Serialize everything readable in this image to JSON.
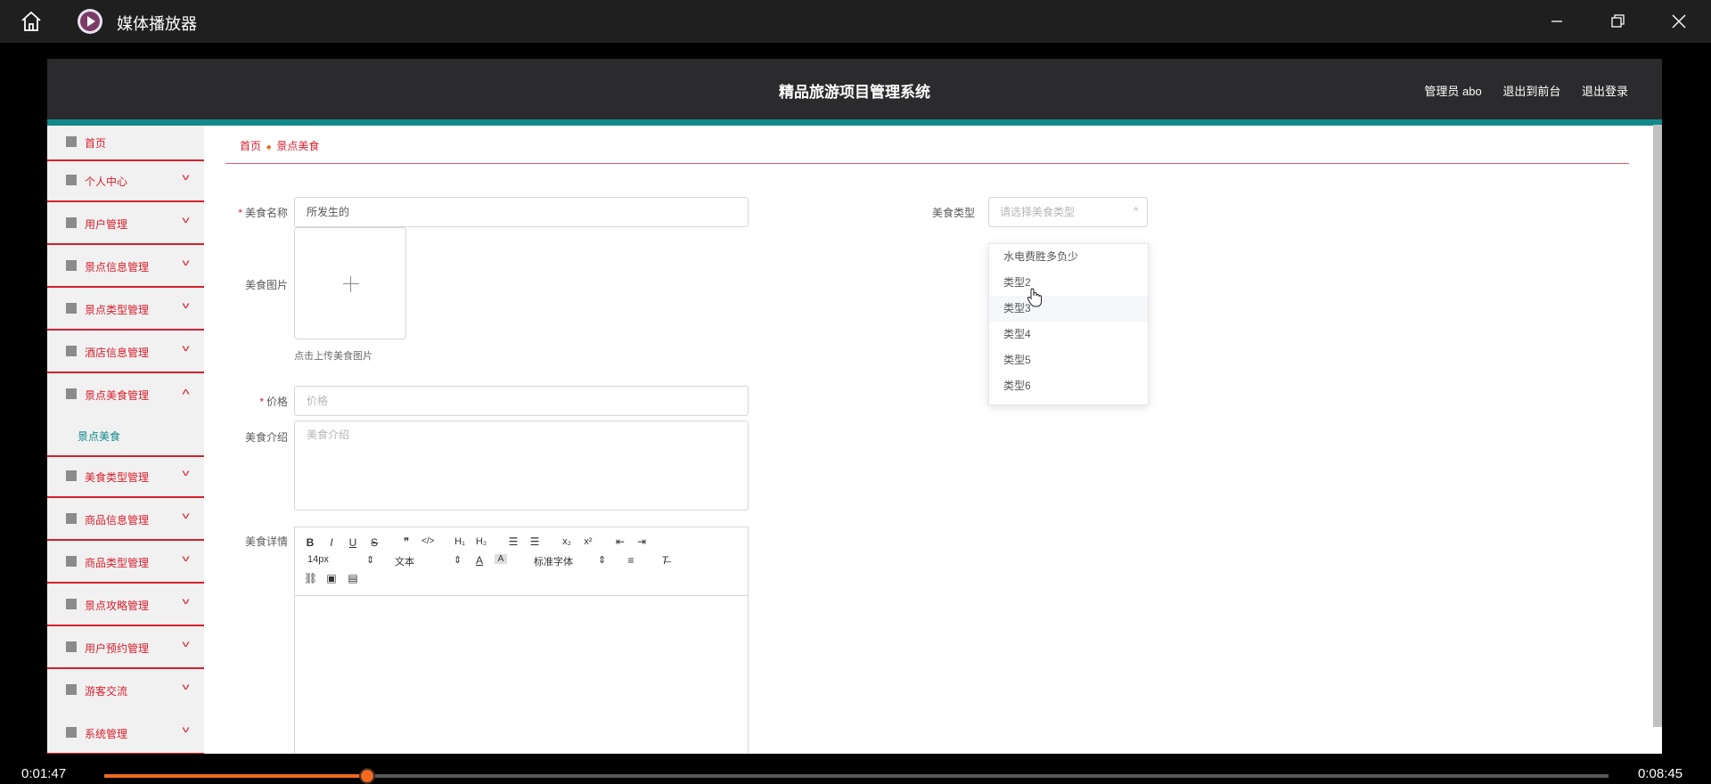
{
  "window": {
    "title": "媒体播放器",
    "icons": [
      "home-icon",
      "media-player-logo",
      "minimize-icon",
      "restore-icon",
      "close-icon"
    ]
  },
  "app": {
    "title": "精品旅游项目管理系统",
    "user_label": "管理员 abo",
    "front_link": "退出到前台",
    "logout_link": "退出登录"
  },
  "sidebar": {
    "items": [
      {
        "label": "首页",
        "icon": "home-icon"
      },
      {
        "label": "个人中心",
        "icon": "user-icon"
      },
      {
        "label": "用户管理",
        "icon": "sliders-icon"
      },
      {
        "label": "景点信息管理",
        "icon": "bar-icon"
      },
      {
        "label": "景点类型管理",
        "icon": "grid-icon"
      },
      {
        "label": "酒店信息管理",
        "icon": "chart-icon"
      },
      {
        "label": "景点美食管理",
        "icon": "image-icon"
      },
      {
        "label": "美食类型管理",
        "icon": "mic-icon"
      },
      {
        "label": "商品信息管理",
        "icon": "clock-icon"
      },
      {
        "label": "商品类型管理",
        "icon": "stats-icon"
      },
      {
        "label": "景点攻略管理",
        "icon": "bell-off-icon"
      },
      {
        "label": "用户预约管理",
        "icon": "phone-icon"
      },
      {
        "label": "游客交流",
        "icon": "briefcase-icon"
      },
      {
        "label": "系统管理",
        "icon": "compass-icon"
      }
    ],
    "active_sub": "景点美食"
  },
  "breadcrumb": {
    "home": "首页",
    "current": "景点美食"
  },
  "form": {
    "name_label": "美食名称",
    "name_value": "所发生的",
    "type_label": "美食类型",
    "type_placeholder": "请选择美食类型",
    "image_label": "美食图片",
    "upload_hint": "点击上传美食图片",
    "price_label": "价格",
    "price_placeholder": "价格",
    "intro_label": "美食介绍",
    "intro_placeholder": "美食介绍",
    "detail_label": "美食详情"
  },
  "editor": {
    "font_size": "14px",
    "header_select": "文本",
    "font_select": "标准字体"
  },
  "dropdown": {
    "options": [
      "水电费胜多负少",
      "类型2",
      "类型3",
      "类型4",
      "类型5",
      "类型6"
    ],
    "hovered": "类型3"
  },
  "player": {
    "current_time": "0:01:47",
    "total_time": "0:08:45",
    "progress": 0.175
  },
  "colors": {
    "accent_red": "#d7202e",
    "teal": "#11898a",
    "header_bg": "#2b2b2d",
    "seek_orange": "#ef6a1f"
  }
}
